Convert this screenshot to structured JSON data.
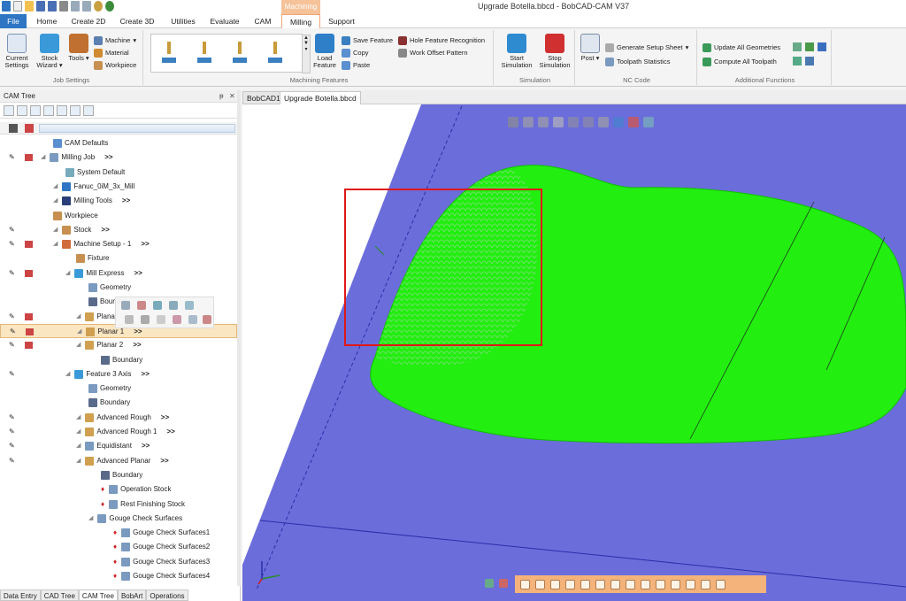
{
  "window": {
    "title": "Upgrade Botella.bbcd - BobCAD-CAM V37"
  },
  "ribbon_tabs": {
    "contextual_label": "Machining",
    "file": "File",
    "home": "Home",
    "create2d": "Create 2D",
    "create3d": "Create 3D",
    "utilities": "Utilities",
    "evaluate": "Evaluate",
    "cam": "CAM",
    "milling": "Milling",
    "support": "Support"
  },
  "ribbon": {
    "job_settings": {
      "label": "Job Settings",
      "current_settings": "Current Settings",
      "stock_wizard": "Stock Wizard",
      "tools": "Tools",
      "machine": "Machine",
      "material": "Material",
      "workpiece": "Workpiece"
    },
    "machining_features": {
      "label": "Machining Features",
      "load_feature": "Load Feature",
      "save_feature": "Save Feature",
      "copy": "Copy",
      "paste": "Paste",
      "hole_feature_recognition": "Hole Feature Recognition",
      "work_offset_pattern": "Work Offset Pattern"
    },
    "simulation": {
      "label": "Simulation",
      "start_simulation": "Start Simulation",
      "stop_simulation": "Stop Simulation"
    },
    "nc_code": {
      "label": "NC Code",
      "post": "Post",
      "generate_setup_sheet": "Generate Setup Sheet",
      "toolpath_statistics": "Toolpath Statistics"
    },
    "additional_functions": {
      "label": "Additional Functions",
      "update_all_geometries": "Update All Geometries",
      "compute_all_toolpath": "Compute All Toolpath"
    }
  },
  "cam_tree": {
    "title": "CAM Tree",
    "pin": "ᵽ",
    "close": "✕",
    "rows": [
      {
        "label": "CAM Defaults"
      },
      {
        "label": "Milling Job",
        "more": ">>"
      },
      {
        "label": "System Default"
      },
      {
        "label": "Fanuc_0iM_3x_Mill"
      },
      {
        "label": "Milling Tools",
        "more": ">>"
      },
      {
        "label": "Workpiece"
      },
      {
        "label": "Stock",
        "more": ">>"
      },
      {
        "label": "Machine Setup - 1",
        "more": ">>"
      },
      {
        "label": "Fixture"
      },
      {
        "label": "Mill Express",
        "more": ">>"
      },
      {
        "label": "Geometry"
      },
      {
        "label": "Boundary"
      },
      {
        "label": "Planar"
      },
      {
        "label": "Planar 1",
        "more": ">>"
      },
      {
        "label": "Planar 2",
        "more": ">>"
      },
      {
        "label": "Boundary"
      },
      {
        "label": "Feature 3 Axis",
        "more": ">>"
      },
      {
        "label": "Geometry"
      },
      {
        "label": "Boundary"
      },
      {
        "label": "Advanced Rough",
        "more": ">>"
      },
      {
        "label": "Advanced Rough 1",
        "more": ">>"
      },
      {
        "label": "Equidistant",
        "more": ">>"
      },
      {
        "label": "Advanced Planar",
        "more": ">>"
      },
      {
        "label": "Boundary"
      },
      {
        "label": "Operation Stock"
      },
      {
        "label": "Rest Finishing Stock"
      },
      {
        "label": "Gouge Check Surfaces"
      },
      {
        "label": "Gouge Check Surfaces1"
      },
      {
        "label": "Gouge Check Surfaces2"
      },
      {
        "label": "Gouge Check Surfaces3"
      },
      {
        "label": "Gouge Check Surfaces4"
      }
    ]
  },
  "bottom_tabs": [
    "Data Entry",
    "CAD Tree",
    "CAM Tree",
    "BobArt",
    "Operations"
  ],
  "doc_tabs": [
    "BobCAD1",
    "Upgrade Botella.bbcd"
  ],
  "colors": {
    "plane": "#6b6ddb",
    "part": "#22ee10",
    "highlight": "#e01818",
    "ribbon_accent": "#f3b37a",
    "file_tab": "#2e75c3"
  }
}
